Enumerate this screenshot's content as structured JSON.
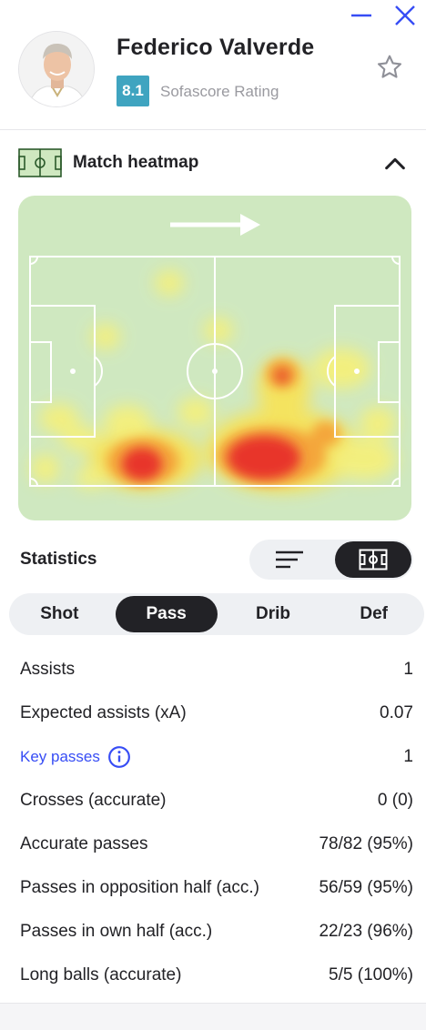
{
  "window": {
    "minimize_icon": "minus-icon",
    "close_icon": "close-icon",
    "accent": "#374df5"
  },
  "player": {
    "name": "Federico Valverde",
    "rating": "8.1",
    "rating_label": "Sofascore Rating",
    "rating_color": "#3fa4c0"
  },
  "heatmap": {
    "title": "Match heatmap",
    "icon": "pitch-icon",
    "collapse_icon": "chevron-up-icon"
  },
  "statistics": {
    "title": "Statistics",
    "view_options": [
      "list-icon",
      "pitch-icon"
    ],
    "active_view": "pitch-icon",
    "tabs": [
      {
        "label": "Shot"
      },
      {
        "label": "Pass"
      },
      {
        "label": "Drib"
      },
      {
        "label": "Def"
      }
    ],
    "active_tab": "Pass",
    "rows": [
      {
        "label": "Assists",
        "value": "1"
      },
      {
        "label": "Expected assists (xA)",
        "value": "0.07"
      },
      {
        "label": "Key passes",
        "value": "1"
      },
      {
        "label": "Crosses (accurate)",
        "value": "0 (0)"
      },
      {
        "label": "Accurate passes",
        "value": "78/82 (95%)"
      },
      {
        "label": "Passes in opposition half (acc.)",
        "value": "56/59 (95%)"
      },
      {
        "label": "Passes in own half (acc.)",
        "value": "22/23 (96%)"
      },
      {
        "label": "Long balls (accurate)",
        "value": "5/5 (100%)"
      }
    ]
  }
}
